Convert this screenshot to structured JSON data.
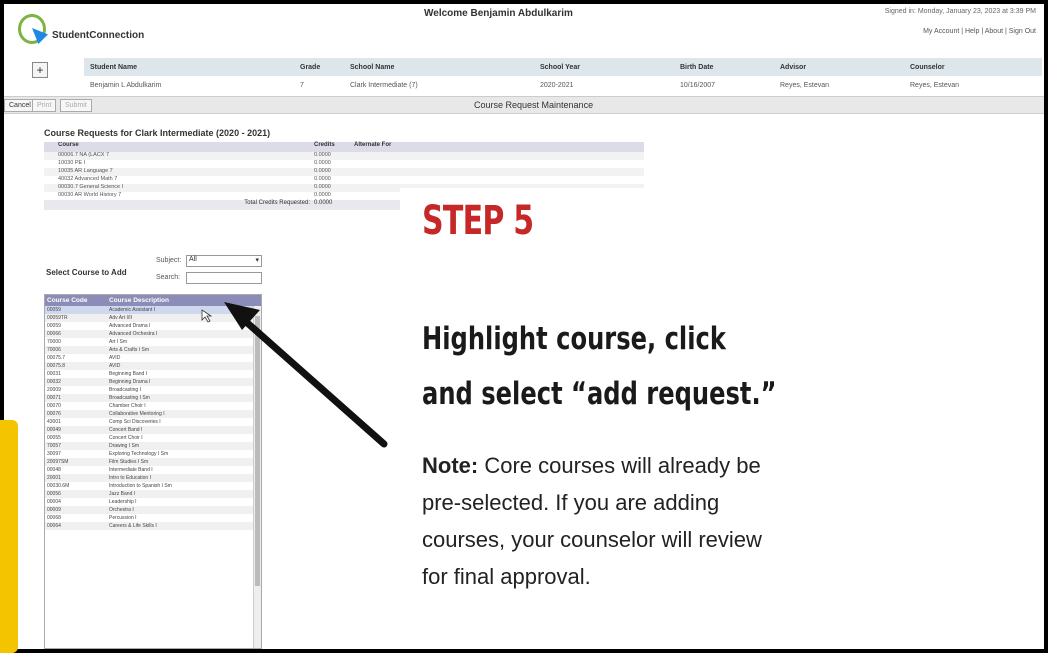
{
  "app": {
    "logo_text": "StudentConnection",
    "welcome": "Welcome Benjamin Abdulkarim",
    "signed_in": "Signed in: Monday, January 23, 2023 at 3:39 PM",
    "links": [
      "My Account",
      "Help",
      "About",
      "Sign Out"
    ]
  },
  "student": {
    "headers": [
      "Student Name",
      "Grade",
      "School Name",
      "School Year",
      "Birth Date",
      "Advisor",
      "Counselor"
    ],
    "values": [
      "Benjamin L Abdulkarim",
      "7",
      "Clark Intermediate (7)",
      "2020-2021",
      "10/16/2007",
      "Reyes, Estevan",
      "Reyes, Estevan"
    ]
  },
  "actions": {
    "cancel": "Cancel",
    "print": "Print",
    "submit": "Submit",
    "title": "Course Request Maintenance"
  },
  "course_requests": {
    "title": "Course Requests for Clark Intermediate (2020 - 2021)",
    "headers": [
      "Course",
      "Credits",
      "Alternate For"
    ],
    "rows": [
      [
        "00006.7 NA (LACX 7",
        "0.0000",
        ""
      ],
      [
        "10030 PE I",
        "0.0000",
        ""
      ],
      [
        "10035 AR Language 7",
        "0.0000",
        ""
      ],
      [
        "40032 Advanced Math 7",
        "0.0000",
        ""
      ],
      [
        "00030.7 General Science I",
        "0.0000",
        ""
      ],
      [
        "00030 AR World History 7",
        "0.0000",
        ""
      ]
    ],
    "total_label": "Total Credits Requested:",
    "total_value": "0.0000"
  },
  "select_course": {
    "title": "Select Course to Add",
    "subject_label": "Subject:",
    "subject_value": "All",
    "search_label": "Search:",
    "list_headers": [
      "Course Code",
      "Course Description"
    ],
    "courses": [
      [
        "00059",
        "Academic Assistant I"
      ],
      [
        "00059TR",
        "Adv Art I/II"
      ],
      [
        "00059",
        "Advanced Drama I"
      ],
      [
        "00066",
        "Advanced Orchestra I"
      ],
      [
        "70000",
        "Art I Sm"
      ],
      [
        "70006",
        "Arts & Crafts I Sm"
      ],
      [
        "00075.7",
        "AVID"
      ],
      [
        "00075.8",
        "AVID"
      ],
      [
        "00031",
        "Beginning Band I"
      ],
      [
        "00032",
        "Beginning Drama I"
      ],
      [
        "20009",
        "Broadcasting I"
      ],
      [
        "00071",
        "Broadcasting I Sm"
      ],
      [
        "00070",
        "Chamber Choir I"
      ],
      [
        "00076",
        "Collaborative Mentoring I"
      ],
      [
        "43001",
        "Comp Sci Discoveries I"
      ],
      [
        "00049",
        "Concert Band I"
      ],
      [
        "00055",
        "Concert Choir I"
      ],
      [
        "70057",
        "Drawing I Sm"
      ],
      [
        "30097",
        "Exploring Technology I Sm"
      ],
      [
        "20097SM",
        "Film Studies I Sm"
      ],
      [
        "00048",
        "Intermediate Band I"
      ],
      [
        "20001",
        "Intro to Education I"
      ],
      [
        "00030.6M",
        "Introduction to Spanish I Sm"
      ],
      [
        "00056",
        "Jazz Band I"
      ],
      [
        "00004",
        "Leadership I"
      ],
      [
        "00009",
        "Orchestra I"
      ],
      [
        "00068",
        "Percussion I"
      ],
      [
        "00064",
        "Careers & Life Skills I"
      ]
    ]
  },
  "overlay": {
    "step": "STEP 5",
    "instruction_line1": "Highlight course, click",
    "instruction_line2": "and select “add request.”",
    "note_label": "Note:",
    "note_line1": " Core courses will already be",
    "note_line2": "pre-selected. If you are adding",
    "note_line3": "courses, your counselor will review",
    "note_line4": "for final approval."
  },
  "colors": {
    "step_red": "#c62828",
    "list_header": "#8c8cb8",
    "accent_yellow": "#f5c400"
  }
}
